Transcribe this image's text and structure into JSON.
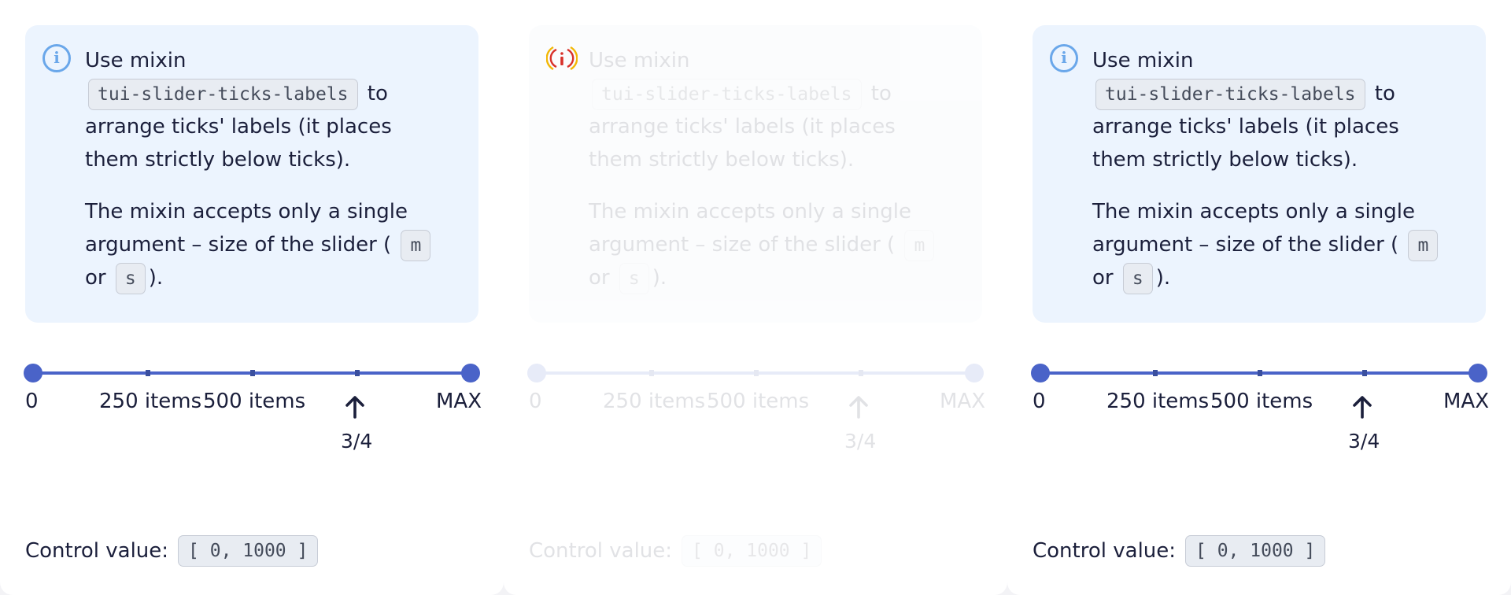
{
  "notice": {
    "line1": "Use mixin",
    "mixin_code": "tui-slider-ticks-labels",
    "line1_suffix": "to arrange ticks' labels (it places them strictly below ticks).",
    "line2_prefix": "The mixin accepts only a single argument – size of the slider (",
    "size_m": "m",
    "or_text": "or",
    "size_s": "s",
    "line2_suffix": ")."
  },
  "slider": {
    "labels": [
      "0",
      "250 items",
      "500 items",
      "MAX"
    ],
    "fraction_label": "3/4",
    "value": [
      0,
      1000
    ],
    "max": 1000,
    "tick_count": 5
  },
  "control": {
    "label": "Control value:",
    "value": "[ 0, 1000 ]"
  },
  "icons": {
    "info": "info-icon",
    "arrow": "arrow-up-icon",
    "disabled_info": "disabled-info-icon"
  },
  "colors": {
    "accent": "#4a63c8",
    "notice_bg": "#ecf4fe",
    "info_icon": "#6aa7ea",
    "text": "#1b1f3b"
  },
  "panels": [
    "default",
    "disabled",
    "default"
  ]
}
